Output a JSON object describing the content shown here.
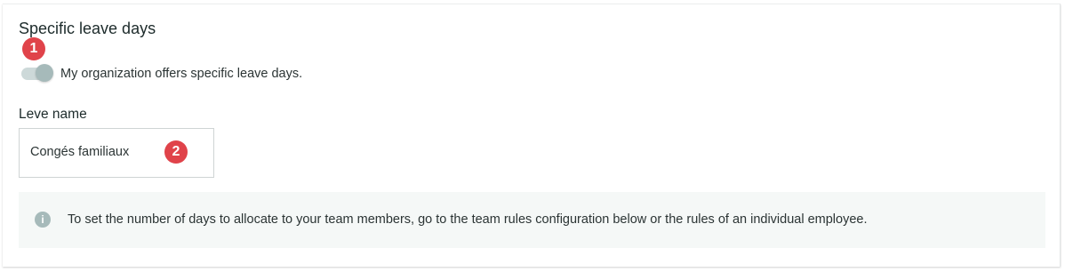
{
  "section": {
    "title": "Specific leave days"
  },
  "toggle": {
    "label": "My organization offers specific leave days.",
    "checked": true,
    "track_color": "#cdd9d9",
    "thumb_color": "#a6baba"
  },
  "field": {
    "label": "Leve name",
    "value": "Congés familiaux"
  },
  "info": {
    "icon": "info-circle-icon",
    "icon_glyph": "i",
    "text": "To set the number of days to allocate to your team members, go to the team rules configuration below or the rules of an individual employee."
  },
  "annotations": {
    "badge_1": "1",
    "badge_2": "2",
    "color": "#e0434a"
  }
}
